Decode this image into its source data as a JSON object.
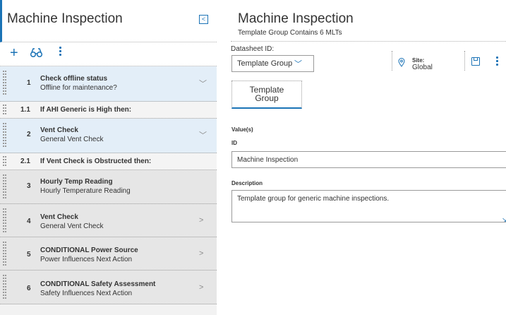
{
  "left": {
    "title": "Machine Inspection",
    "collapse_glyph": "<",
    "toolbar": {
      "add_glyph": "+",
      "icons": [
        "plus-icon",
        "binoculars-icon",
        "more-vertical-icon"
      ]
    },
    "items": [
      {
        "num": "1",
        "title": "Check offline status",
        "subtitle": "Offline for maintenance?",
        "chev": "﹀",
        "style": "selected"
      },
      {
        "num": "1.1",
        "condition": "If AHI Generic is High then:"
      },
      {
        "num": "2",
        "title": "Vent Check",
        "subtitle": "General Vent Check",
        "chev": "﹀",
        "style": "selected"
      },
      {
        "num": "2.1",
        "condition": "If Vent Check is Obstructed then:"
      },
      {
        "num": "3",
        "title": "Hourly Temp Reading",
        "subtitle": "Hourly Temperature Reading",
        "chev": "",
        "style": "grey"
      },
      {
        "num": "4",
        "title": "Vent Check",
        "subtitle": "General Vent Check",
        "chev": ">",
        "style": "grey"
      },
      {
        "num": "5",
        "title": "CONDITIONAL Power Source",
        "subtitle": "Power Influences Next Action",
        "chev": ">",
        "style": "grey"
      },
      {
        "num": "6",
        "title": "CONDITIONAL Safety Assessment",
        "subtitle": "Safety Influences Next Action",
        "chev": ">",
        "style": "grey"
      }
    ]
  },
  "right": {
    "title": "Machine Inspection",
    "subtitle": "Template Group Contains 6 MLTs",
    "datasheet_label": "Datasheet ID:",
    "datasheet_value": "Template Group",
    "datasheet_chev": "﹀",
    "site_label": "Site:",
    "site_value": "Global",
    "tab_label_line1": "Template",
    "tab_label_line2": "Group",
    "values_label": "Value(s)",
    "id_label": "ID",
    "id_value": "Machine Inspection",
    "description_label": "Description",
    "description_value": "Template group for generic machine inspections.",
    "resize_glyph": "↘"
  },
  "colors": {
    "accent": "#1b73b6",
    "selected_row": "#e3eef8",
    "grey_row": "#e6e6e6"
  }
}
